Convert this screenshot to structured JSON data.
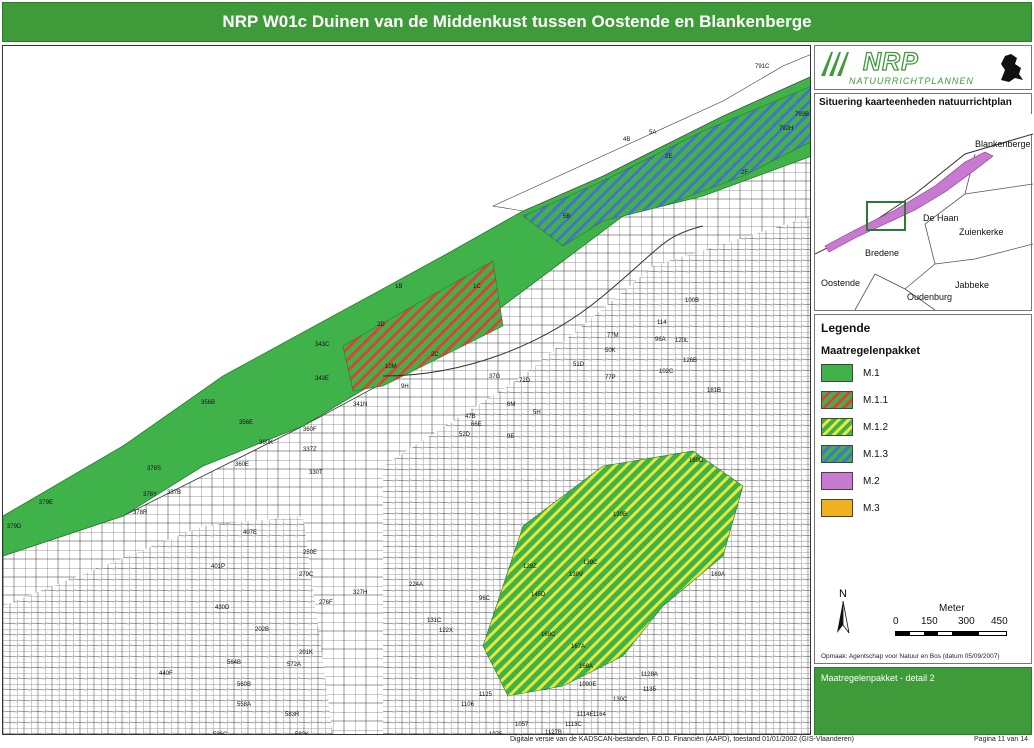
{
  "title": "NRP W01c Duinen van de Middenkust tussen Oostende en Blankenberge",
  "logo": {
    "name": "NRP",
    "subtitle": "NATUURRICHTPLANNEN",
    "icon": "flemish-lion-icon"
  },
  "situering": {
    "title": "Situering kaarteenheden natuurrichtplan",
    "places": [
      "Blankenberge",
      "De Haan",
      "Zuienkerke",
      "Bredene",
      "Oostende",
      "Jabbeke",
      "Oudenburg"
    ]
  },
  "legend": {
    "title": "Legende",
    "subtitle": "Maatregelenpakket",
    "items": [
      {
        "label": "M.1",
        "color": "#3fb34a",
        "pattern": "solid"
      },
      {
        "label": "M.1.1",
        "color": "#3fb34a",
        "stripe": "#e0403a",
        "pattern": "hatched"
      },
      {
        "label": "M.1.2",
        "color": "#3fb34a",
        "stripe": "#e8e83a",
        "pattern": "hatched"
      },
      {
        "label": "M.1.3",
        "color": "#3fb34a",
        "stripe": "#4a6fd0",
        "pattern": "hatched"
      },
      {
        "label": "M.2",
        "color": "#c77ad0",
        "pattern": "solid"
      },
      {
        "label": "M.3",
        "color": "#f0b020",
        "pattern": "solid"
      }
    ]
  },
  "scale": {
    "unit": "Meter",
    "ticks": [
      "0",
      "150",
      "300",
      "450"
    ]
  },
  "north": "N",
  "opmaak": "Opmaak: Agentschap voor Natuur en Bos (datum 05/09/2007)",
  "detail": "Maatregelenpakket - detail 2",
  "footer": {
    "source": "Digitale versie van de KADSCAN-bestanden, F.O.D. Financiën (AAPD), toestand 01/01/2002 (GIS-Vlaanderen)",
    "page": "Pagina 11 van 14"
  },
  "map_labels": [
    "791C",
    "793B",
    "792H",
    "4B",
    "5A",
    "2E",
    "2F",
    "5B",
    "1B",
    "1C",
    "2D",
    "2C",
    "10M",
    "9H",
    "343C",
    "343E",
    "356B",
    "356E",
    "378S",
    "379E",
    "379D",
    "341N",
    "360F",
    "360E",
    "360K",
    "337Z",
    "330T",
    "337B",
    "378Y",
    "378R",
    "407E",
    "401P",
    "430D",
    "440F",
    "564B",
    "560B",
    "558A",
    "572A",
    "583R",
    "592K",
    "536C",
    "202B",
    "201K",
    "327H",
    "276F",
    "279C",
    "250E",
    "224A",
    "129Z",
    "139C",
    "139B",
    "139V",
    "145D",
    "169C",
    "167A",
    "168A",
    "189D",
    "181B",
    "169A",
    "126B",
    "100B",
    "114",
    "96A",
    "77P",
    "77M",
    "50K",
    "51D",
    "47B",
    "66E",
    "52D",
    "9E",
    "6M",
    "5H",
    "72D",
    "37G",
    "120L",
    "102C",
    "1128A",
    "1135",
    "1090E",
    "1057",
    "1075",
    "1106",
    "1125",
    "1127B",
    "1113C",
    "1114E",
    "1164",
    "130C",
    "131C",
    "122X",
    "96C"
  ]
}
